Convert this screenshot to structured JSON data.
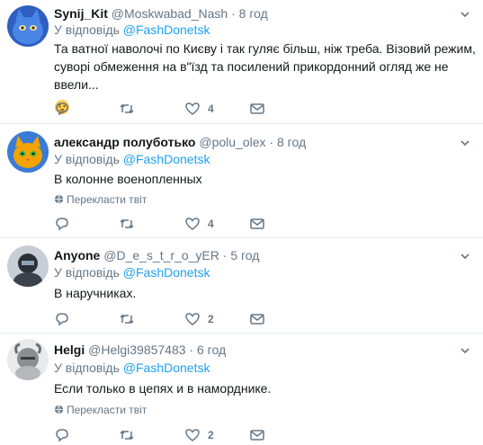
{
  "reply_prefix": "У відповідь",
  "translate_label": "Перекласти твіт",
  "tweets": [
    {
      "name": "Synij_Kit",
      "handle": "@Moskwabad_Nash",
      "dot": "·",
      "time": "8 год",
      "mention": "@FashDonetsk",
      "text": "Та ватної наволочі по Києву і так гуляє більш, ніж треба. Візовий режим, суворі обмеження на в\"їзд та посилений прикордонний огляд же не ввели...",
      "emoji": "thinking-face-emoji",
      "likes": "4"
    },
    {
      "name": "александр полуботько",
      "handle": "@polu_olex",
      "dot": "·",
      "time": "8 год",
      "mention": "@FashDonetsk",
      "text": "В колонне военопленных",
      "likes": "4"
    },
    {
      "name": "Anyone",
      "handle": "@D_e_s_t_r_o_yER",
      "dot": "·",
      "time": "5 год",
      "mention": "@FashDonetsk",
      "text": "В наручниках.",
      "likes": "2"
    },
    {
      "name": "Helgi",
      "handle": "@Helgi39857483",
      "dot": "·",
      "time": "6 год",
      "mention": "@FashDonetsk",
      "text": "Если только в цепях и в наморднике.",
      "likes": "2"
    }
  ],
  "colors": {
    "accent": "#1da1f2",
    "muted": "#657786",
    "divider": "#e6ecf0"
  }
}
